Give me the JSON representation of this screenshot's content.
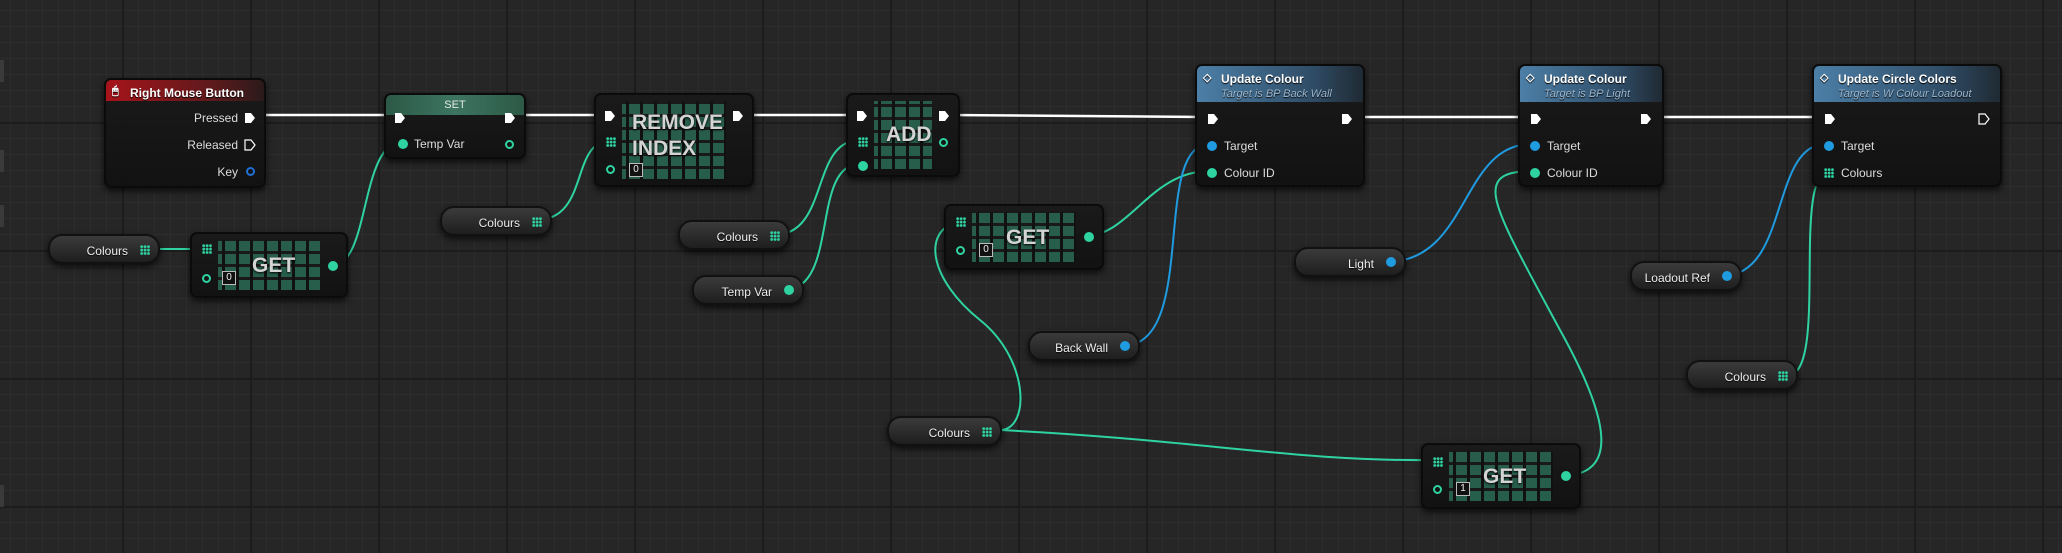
{
  "colors": {
    "exec": "#ffffff",
    "array_pin": "#2ed3a1",
    "object_pin": "#1f9be0",
    "event_header": "#a7141a",
    "function_header": "#4c7fa7"
  },
  "events": {
    "right_mouse": {
      "title": "Right Mouse Button",
      "icon": "mouse-icon",
      "pins": {
        "pressed": "Pressed",
        "released": "Released",
        "key": "Key"
      }
    }
  },
  "nodes": {
    "set": {
      "title": "SET",
      "input": "Temp Var"
    },
    "remove_index": {
      "title": "REMOVE INDEX",
      "index": "0"
    },
    "add": {
      "title": "ADD"
    },
    "get_a": {
      "title": "GET",
      "index": "0"
    },
    "get_b": {
      "title": "GET",
      "index": "0"
    },
    "get_c": {
      "title": "GET",
      "index": "1"
    },
    "update_colour_1": {
      "title": "Update Colour",
      "subtitle": "Target is BP Back Wall",
      "pin_target": "Target",
      "pin_param": "Colour ID"
    },
    "update_colour_2": {
      "title": "Update Colour",
      "subtitle": "Target is BP Light",
      "pin_target": "Target",
      "pin_param": "Colour ID"
    },
    "update_circle": {
      "title": "Update Circle Colors",
      "subtitle": "Target is W Colour Loadout",
      "pin_target": "Target",
      "pin_param": "Colours"
    }
  },
  "variables": {
    "colours_1": "Colours",
    "colours_2": "Colours",
    "colours_3": "Colours",
    "colours_4": "Colours",
    "colours_5": "Colours",
    "temp_var": "Temp Var",
    "back_wall": "Back Wall",
    "light": "Light",
    "loadout_ref": "Loadout Ref"
  }
}
